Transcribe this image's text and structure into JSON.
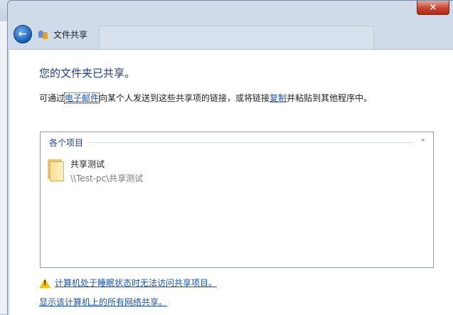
{
  "window": {
    "title": "文件共享",
    "close_glyph": "×"
  },
  "main": {
    "heading": "您的文件夹已共享。",
    "desc": {
      "prefix": "可通过",
      "email_link": "电子邮件",
      "middle": "向某个人发送到这些共享项的链接，或将链接",
      "copy_link": "复制",
      "suffix": "并粘贴到其他程序中。"
    },
    "group": {
      "title": "各个项目",
      "collapse_glyph": "⌃"
    },
    "items": [
      {
        "name": "共享测试",
        "path": "\\\\Test-pc\\共享测试"
      }
    ],
    "warning_link": "计算机处于睡眠状态时无法访问共享项目。",
    "show_all_link": "显示该计算机上的所有网络共享。"
  },
  "colors": {
    "heading": "#1e3d8f",
    "link": "#1a55b8",
    "warning": "#f2c40f"
  }
}
